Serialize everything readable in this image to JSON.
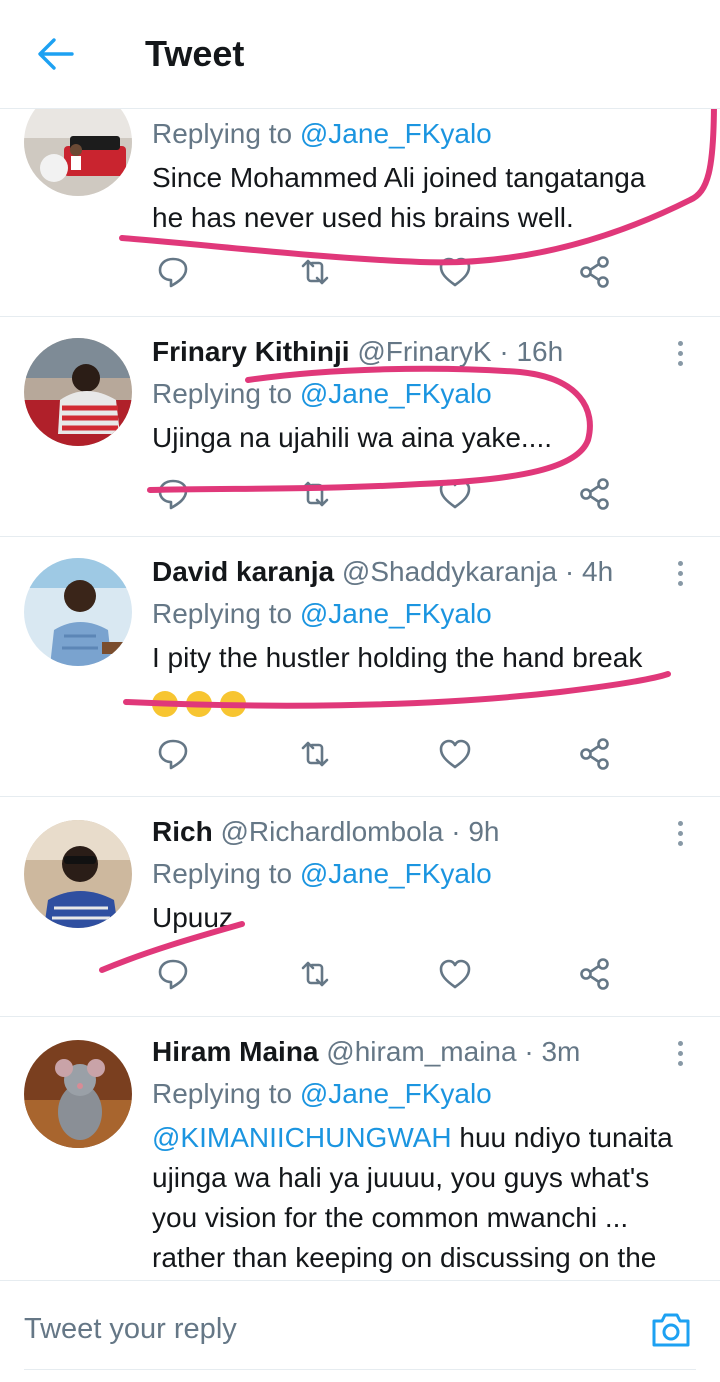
{
  "header": {
    "title": "Tweet"
  },
  "tweets": [
    {
      "name": "",
      "handle": "",
      "time": "",
      "replying_label": "Replying to",
      "replying_to": "@Jane_FKyalo",
      "text_lines": [
        "Since Mohammed Ali joined tangatanga",
        "he has never used his brains well."
      ]
    },
    {
      "name": "Frinary Kithinji",
      "handle": "@FrinaryK",
      "time": "· 16h",
      "replying_label": "Replying to",
      "replying_to": "@Jane_FKyalo",
      "text_lines": [
        "Ujinga na ujahili wa aina yake...."
      ]
    },
    {
      "name": "David karanja",
      "handle": "@Shaddykaranja",
      "time": "· 4h",
      "replying_label": "Replying to",
      "replying_to": "@Jane_FKyalo",
      "text_lines": [
        "I pity the hustler holding the hand break"
      ],
      "emojis": [
        "grinning-sweat-emoji",
        "grinning-sweat-emoji",
        "grinning-sweat-emoji"
      ]
    },
    {
      "name": "Rich",
      "handle": "@Richardlombola",
      "time": "· 9h",
      "replying_label": "Replying to",
      "replying_to": "@Jane_FKyalo",
      "text_lines": [
        "Upuuz"
      ]
    },
    {
      "name": "Hiram Maina",
      "handle": "@hiram_maina",
      "time": "· 3m",
      "replying_label": "Replying to",
      "replying_to": "@Jane_FKyalo",
      "mention": "@KIMANIICHUNGWAH",
      "text_lines": [
        " huu ndiyo tunaita",
        "ujinga wa hali ya juuuu, you guys what's",
        "you vision for the common mwanchi ...",
        "rather than keeping on discussing on the"
      ]
    }
  ],
  "composer": {
    "placeholder": "Tweet your reply"
  },
  "icons": {
    "back": "arrow-left-icon",
    "more": "more-vertical-icon",
    "reply": "reply-icon",
    "retweet": "retweet-icon",
    "like": "heart-icon",
    "share": "share-icon",
    "camera": "camera-icon"
  },
  "colors": {
    "accent": "#1da1f2",
    "mention": "#1b95e0",
    "secondary_text": "#657786",
    "icon_gray": "#657786",
    "annotation_pink": "#e0387a"
  }
}
